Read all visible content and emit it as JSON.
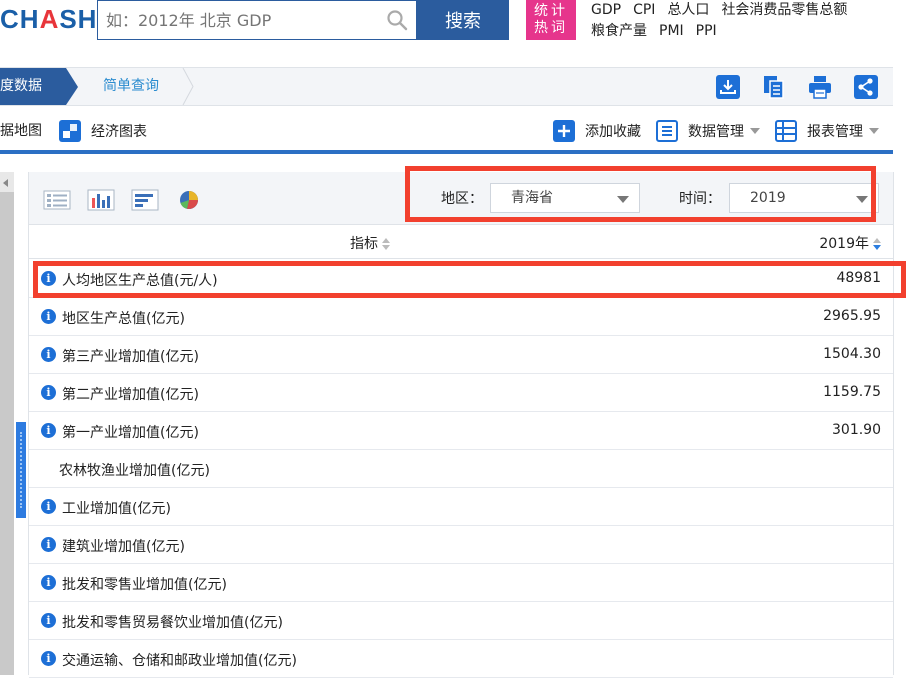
{
  "header": {
    "logo_main": "CH",
    "logo_acc": "A",
    "logo_rest": "SHU",
    "search_placeholder": "如：2012年 北京 GDP",
    "search_button": "搜索",
    "hot_badge_line1": "统计",
    "hot_badge_line2": "热词",
    "hot_links": [
      "GDP",
      "CPI",
      "总人口",
      "社会消费品零售总额",
      "粮食产量",
      "PMI",
      "PPI"
    ]
  },
  "crumb": {
    "active": "度数据",
    "next": "简单查询"
  },
  "toolbar_icons": [
    "download-icon",
    "copy-icon",
    "print-icon",
    "share-icon"
  ],
  "nav": {
    "map_label": "据地图",
    "chart_label": "经济图表",
    "add_fav": "添加收藏",
    "data_mgmt": "数据管理",
    "report_mgmt": "报表管理"
  },
  "filter": {
    "region_label": "地区：",
    "region_value": "青海省",
    "time_label": "时间：",
    "time_value": "2019"
  },
  "table": {
    "col_indicator": "指标",
    "col_year": "2019年",
    "rows": [
      {
        "name": "人均地区生产总值(元/人)",
        "value": "48981",
        "icon": true
      },
      {
        "name": "地区生产总值(亿元)",
        "value": "2965.95",
        "icon": true
      },
      {
        "name": "第三产业增加值(亿元)",
        "value": "1504.30",
        "icon": true
      },
      {
        "name": "第二产业增加值(亿元)",
        "value": "1159.75",
        "icon": true
      },
      {
        "name": "第一产业增加值(亿元)",
        "value": "301.90",
        "icon": true
      },
      {
        "name": "农林牧渔业增加值(亿元)",
        "value": "",
        "icon": false
      },
      {
        "name": "工业增加值(亿元)",
        "value": "",
        "icon": true
      },
      {
        "name": "建筑业增加值(亿元)",
        "value": "",
        "icon": true
      },
      {
        "name": "批发和零售业增加值(亿元)",
        "value": "",
        "icon": true
      },
      {
        "name": "批发和零售贸易餐饮业增加值(亿元)",
        "value": "",
        "icon": true
      },
      {
        "name": "交通运输、仓储和邮政业增加值(亿元)",
        "value": "",
        "icon": true
      }
    ]
  },
  "colors": {
    "brand_blue": "#2b5c9e",
    "hot_pink": "#e6358c",
    "highlight_red": "#f2402e"
  }
}
